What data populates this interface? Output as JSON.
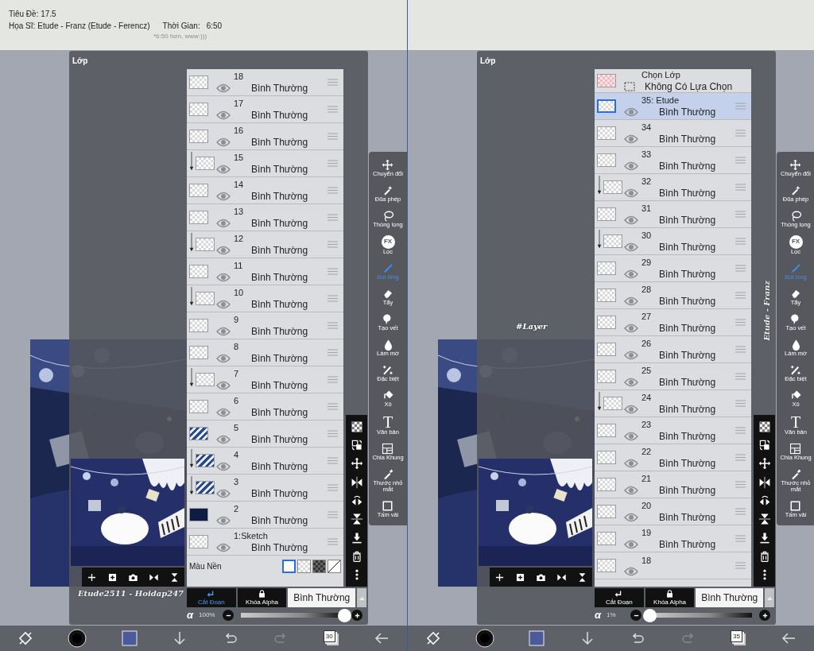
{
  "panes": [
    {
      "info": {
        "title": "Tiêu Đề: 17.5",
        "artist_label": "Họa Sĩ:",
        "artist": "Etude - Franz (Etude - Ferencz)",
        "time_label": "Thời Gian:",
        "time": "6:50",
        "note": "*6:50 hơn, www:)))"
      },
      "panel_title": "Lớp",
      "layers": [
        {
          "name": "18",
          "blend": "Bình Thường",
          "kind": "checker",
          "clipped": false,
          "selected": false
        },
        {
          "name": "17",
          "blend": "Bình Thường",
          "kind": "checker",
          "clipped": false,
          "selected": false
        },
        {
          "name": "16",
          "blend": "Bình Thường",
          "kind": "checker",
          "clipped": false,
          "selected": false
        },
        {
          "name": "15",
          "blend": "Bình Thường",
          "kind": "checker",
          "clipped": true,
          "selected": false
        },
        {
          "name": "14",
          "blend": "Bình Thường",
          "kind": "checker",
          "clipped": false,
          "selected": false
        },
        {
          "name": "13",
          "blend": "Bình Thường",
          "kind": "checker",
          "clipped": false,
          "selected": false
        },
        {
          "name": "12",
          "blend": "Bình Thường",
          "kind": "checker",
          "clipped": true,
          "selected": false
        },
        {
          "name": "11",
          "blend": "Bình Thường",
          "kind": "checker",
          "clipped": false,
          "selected": false
        },
        {
          "name": "10",
          "blend": "Bình Thường",
          "kind": "checker",
          "clipped": true,
          "selected": false
        },
        {
          "name": "9",
          "blend": "Bình Thường",
          "kind": "checker",
          "clipped": false,
          "selected": false
        },
        {
          "name": "8",
          "blend": "Bình Thường",
          "kind": "checker",
          "clipped": false,
          "selected": false
        },
        {
          "name": "7",
          "blend": "Bình Thường",
          "kind": "checker",
          "clipped": true,
          "selected": false
        },
        {
          "name": "6",
          "blend": "Bình Thường",
          "kind": "checker",
          "clipped": false,
          "selected": false
        },
        {
          "name": "5",
          "blend": "Bình Thường",
          "kind": "pattern",
          "clipped": false,
          "selected": false
        },
        {
          "name": "4",
          "blend": "Bình Thường",
          "kind": "pattern",
          "clipped": true,
          "selected": false
        },
        {
          "name": "3",
          "blend": "Bình Thường",
          "kind": "pattern",
          "clipped": true,
          "selected": false
        },
        {
          "name": "2",
          "blend": "Bình Thường",
          "kind": "dark",
          "clipped": false,
          "selected": false
        },
        {
          "name": "1:Sketch",
          "blend": "Bình Thường",
          "kind": "checker",
          "clipped": false,
          "selected": false
        }
      ],
      "background_row": {
        "label": "Màu Nền",
        "swatches": [
          {
            "kind": "white",
            "selected": true
          },
          {
            "kind": "checker",
            "selected": false
          },
          {
            "kind": "dark",
            "selected": false
          },
          {
            "kind": "none",
            "selected": false
          }
        ]
      },
      "clip_button": {
        "label": "Cắt Đoạn",
        "on": true
      },
      "alpha_lock": {
        "label": "Khóa Alpha",
        "on": false
      },
      "blend_mode": "Bình Thường",
      "opacity": {
        "symbol": "α",
        "reading": "100%",
        "level": 1
      },
      "tools": [
        {
          "label": "Chuyển đổi",
          "selected": false
        },
        {
          "label": "Đũa phép",
          "selected": false
        },
        {
          "label": "Thòng lọng",
          "selected": false
        },
        {
          "label": "Lọc",
          "glyph": "FX",
          "selected": false
        },
        {
          "label": "Bút lông",
          "selected": true
        },
        {
          "label": "Tẩy",
          "selected": false
        },
        {
          "label": "Tạo vết",
          "selected": false
        },
        {
          "label": "Làm mờ",
          "selected": false
        },
        {
          "label": "Đặc biệt",
          "selected": false
        },
        {
          "label": "Xô",
          "selected": false
        },
        {
          "label": "Văn bản",
          "glyph": "T",
          "selected": false
        },
        {
          "label": "Chia Khung",
          "selected": false
        },
        {
          "label": "Thước nhỏ mắt",
          "selected": false
        },
        {
          "label": "Tấm vải",
          "selected": false
        }
      ],
      "frame_count": "30",
      "captions": [
        {
          "kind": "signature",
          "text": "Etude2511 - Hoidap247"
        }
      ]
    },
    {
      "panel_title": "Lớp",
      "selection_row": {
        "title": "Chọn Lớp",
        "subtitle": "Không Có Lựa Chọn"
      },
      "layers": [
        {
          "name": "35: Etude",
          "blend": "Bình Thường",
          "kind": "checker",
          "clipped": false,
          "selected": true
        },
        {
          "name": "34",
          "blend": "Bình Thường",
          "kind": "checker",
          "clipped": false,
          "selected": false
        },
        {
          "name": "33",
          "blend": "Bình Thường",
          "kind": "checker",
          "clipped": false,
          "selected": false
        },
        {
          "name": "32",
          "blend": "Bình Thường",
          "kind": "checker",
          "clipped": true,
          "selected": false
        },
        {
          "name": "31",
          "blend": "Bình Thường",
          "kind": "checker",
          "clipped": false,
          "selected": false
        },
        {
          "name": "30",
          "blend": "Bình Thường",
          "kind": "checker",
          "clipped": true,
          "selected": false
        },
        {
          "name": "29",
          "blend": "Bình Thường",
          "kind": "checker",
          "clipped": false,
          "selected": false
        },
        {
          "name": "28",
          "blend": "Bình Thường",
          "kind": "checker",
          "clipped": false,
          "selected": false
        },
        {
          "name": "27",
          "blend": "Bình Thường",
          "kind": "checker",
          "clipped": false,
          "selected": false
        },
        {
          "name": "26",
          "blend": "Bình Thường",
          "kind": "checker",
          "clipped": false,
          "selected": false
        },
        {
          "name": "25",
          "blend": "Bình Thường",
          "kind": "checker",
          "clipped": false,
          "selected": false
        },
        {
          "name": "24",
          "blend": "Bình Thường",
          "kind": "checker",
          "clipped": true,
          "selected": false
        },
        {
          "name": "23",
          "blend": "Bình Thường",
          "kind": "checker",
          "clipped": false,
          "selected": false
        },
        {
          "name": "22",
          "blend": "Bình Thường",
          "kind": "checker",
          "clipped": false,
          "selected": false
        },
        {
          "name": "21",
          "blend": "Bình Thường",
          "kind": "checker",
          "clipped": false,
          "selected": false
        },
        {
          "name": "20",
          "blend": "Bình Thường",
          "kind": "checker",
          "clipped": false,
          "selected": false
        },
        {
          "name": "19",
          "blend": "Bình Thường",
          "kind": "checker",
          "clipped": false,
          "selected": false
        },
        {
          "name": "18",
          "kind": "checker",
          "clipped": false,
          "selected": false
        }
      ],
      "clip_button": {
        "label": "Cắt Đoạn",
        "on": false
      },
      "alpha_lock": {
        "label": "Khóa Alpha",
        "on": false
      },
      "blend_mode": "Bình Thường",
      "opacity": {
        "symbol": "α",
        "reading": "1%",
        "level": 0.01
      },
      "tools": [
        {
          "label": "Chuyển đổi",
          "selected": false
        },
        {
          "label": "Đũa phép",
          "selected": false
        },
        {
          "label": "Thòng lọng",
          "selected": false
        },
        {
          "label": "Lọc",
          "glyph": "FX",
          "selected": false
        },
        {
          "label": "Bút lông",
          "selected": true
        },
        {
          "label": "Tẩy",
          "selected": false
        },
        {
          "label": "Tạo vết",
          "selected": false
        },
        {
          "label": "Làm mờ",
          "selected": false
        },
        {
          "label": "Đặc biệt",
          "selected": false
        },
        {
          "label": "Xô",
          "selected": false
        },
        {
          "label": "Văn bản",
          "glyph": "T",
          "selected": false
        },
        {
          "label": "Chia Khung",
          "selected": false
        },
        {
          "label": "Thước nhỏ mắt",
          "selected": false
        },
        {
          "label": "Tấm vải",
          "selected": false
        }
      ],
      "frame_count": "35",
      "captions": [
        {
          "kind": "tag",
          "text": "#Layer"
        },
        {
          "kind": "vertical",
          "text": "Etude - Franz"
        }
      ]
    }
  ]
}
